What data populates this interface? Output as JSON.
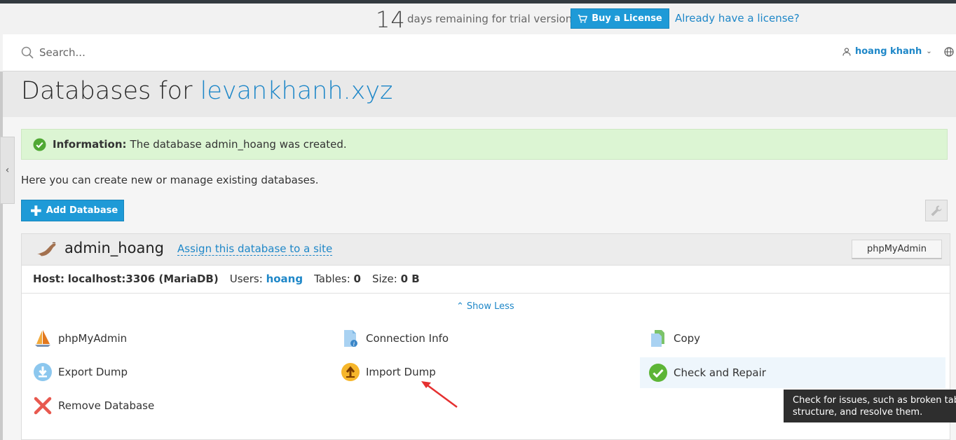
{
  "trial": {
    "days": "14",
    "text": "days remaining for trial version",
    "buy_label": "Buy a License",
    "have_license": "Already have a license?"
  },
  "header": {
    "search_placeholder": "Search...",
    "username": "hoang khanh"
  },
  "page": {
    "title_prefix": "Databases for",
    "title_domain": "levankhanh.xyz",
    "intro": "Here you can create new or manage existing databases."
  },
  "message": {
    "label": "Information:",
    "text": "The database admin_hoang was created."
  },
  "toolbar": {
    "add_database": "Add Database"
  },
  "database": {
    "name": "admin_hoang",
    "assign_link": "Assign this database to a site",
    "phpmyadmin_button": "phpMyAdmin",
    "host_label": "Host:",
    "host_value": "localhost:3306 (MariaDB)",
    "users_label": "Users:",
    "users_value": "hoang",
    "tables_label": "Tables:",
    "tables_value": "0",
    "size_label": "Size:",
    "size_value": "0 B",
    "show_less": "Show Less",
    "actions": {
      "phpmyadmin": "phpMyAdmin",
      "connection_info": "Connection Info",
      "copy": "Copy",
      "export_dump": "Export Dump",
      "import_dump": "Import Dump",
      "check_repair": "Check and Repair",
      "remove": "Remove Database"
    }
  },
  "tooltip": {
    "line1": "Check for issues, such as broken tables",
    "line2": "structure, and resolve them."
  },
  "colors": {
    "accent": "#1e9ad7",
    "link": "#1e87c8",
    "success_bg": "#dcf5d3",
    "danger": "#e8594f"
  }
}
